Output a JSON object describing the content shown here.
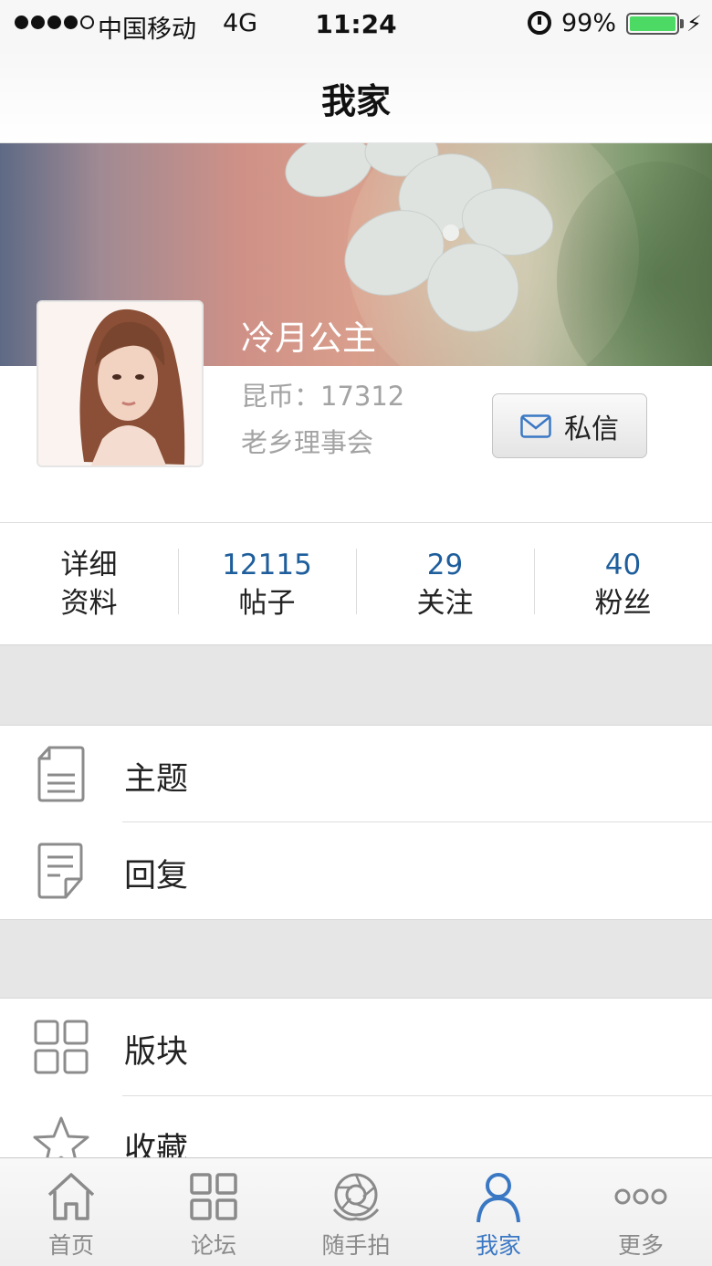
{
  "status_bar": {
    "carrier": "中国移动",
    "network": "4G",
    "time": "11:24",
    "battery_percent": "99%",
    "signal_bars_filled": 4,
    "signal_bars_total": 5
  },
  "nav": {
    "title": "我家"
  },
  "profile": {
    "username": "冷月公主",
    "coins_line": "昆币：17312",
    "group": "老乡理事会",
    "pm_button_label": "私信"
  },
  "stats": [
    {
      "lines": [
        "详细",
        "资料"
      ]
    },
    {
      "value": "12115",
      "label": "帖子"
    },
    {
      "value": "29",
      "label": "关注"
    },
    {
      "value": "40",
      "label": "粉丝"
    }
  ],
  "menu": {
    "section1": [
      {
        "label": "主题",
        "icon": "document-icon"
      },
      {
        "label": "回复",
        "icon": "reply-note-icon"
      }
    ],
    "section2": [
      {
        "label": "版块",
        "icon": "grid-icon"
      },
      {
        "label": "收藏",
        "icon": "star-icon"
      }
    ]
  },
  "tab_bar": {
    "active_index": 3,
    "tabs": [
      {
        "label": "首页",
        "icon": "home-icon"
      },
      {
        "label": "论坛",
        "icon": "grid-icon"
      },
      {
        "label": "随手拍",
        "icon": "camera-aperture-icon"
      },
      {
        "label": "我家",
        "icon": "person-icon"
      },
      {
        "label": "更多",
        "icon": "more-icon"
      }
    ]
  },
  "colors": {
    "accent": "#3b78c4",
    "stat_number": "#1e5e9c",
    "battery": "#4cd964",
    "section_gap": "#e6e6e6"
  }
}
